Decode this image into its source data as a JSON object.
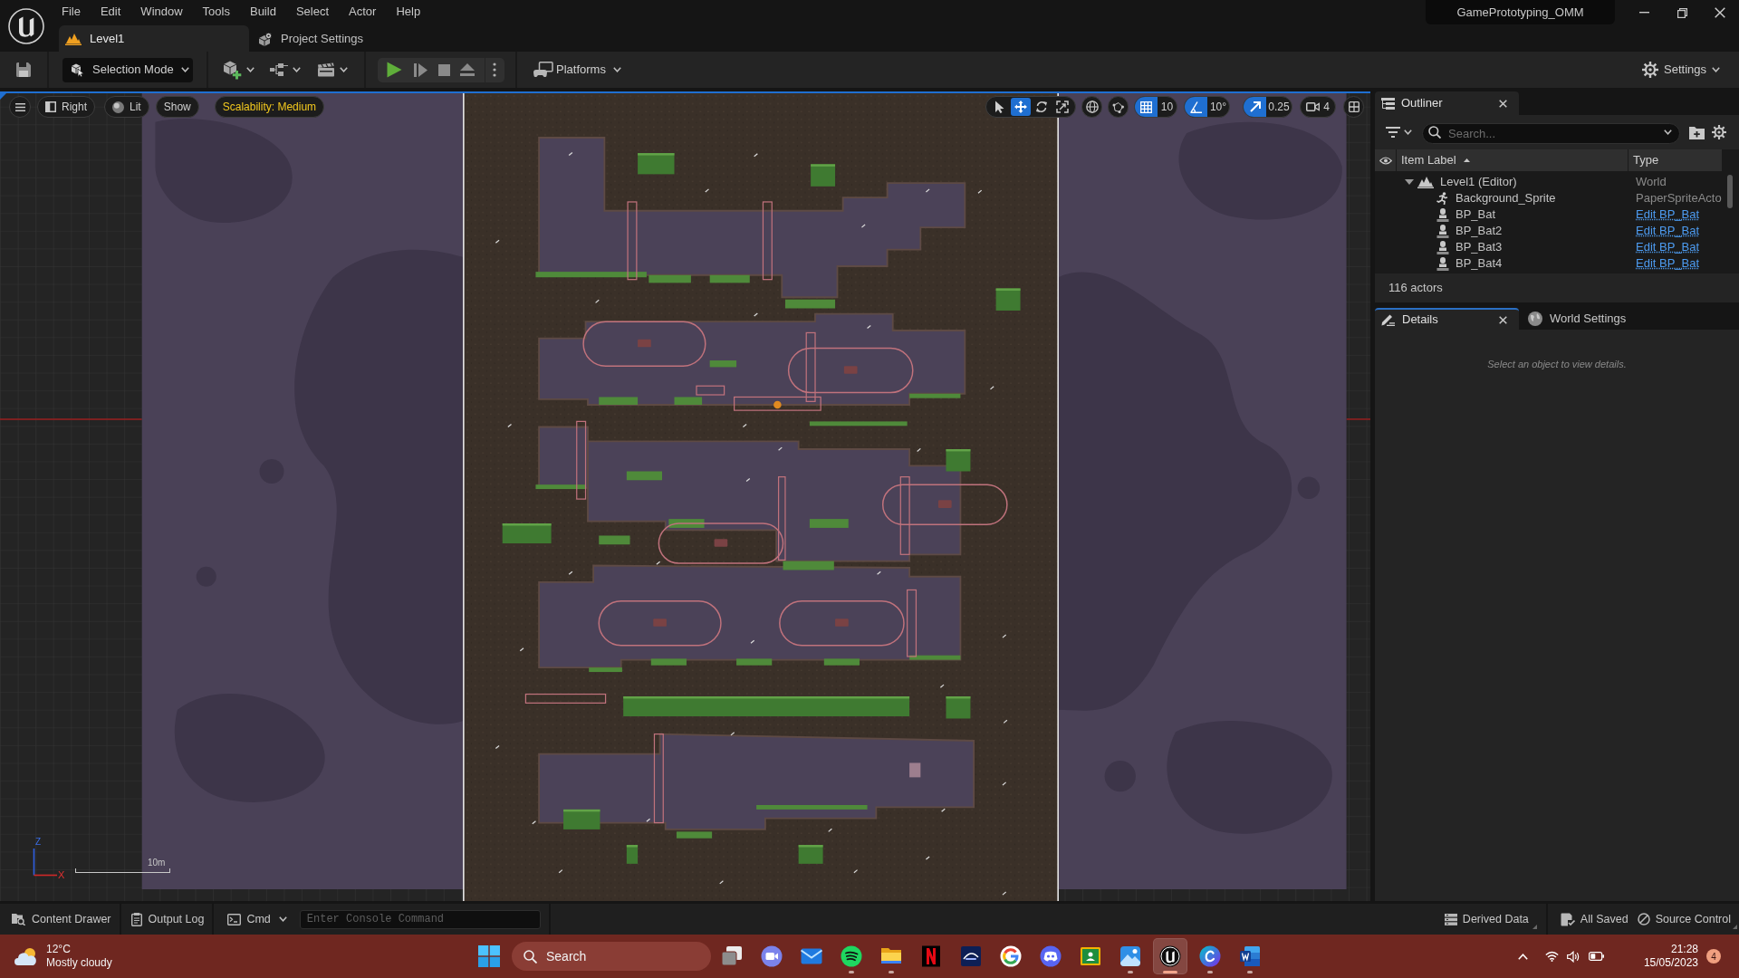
{
  "menu_bar": {
    "items": [
      "File",
      "Edit",
      "Window",
      "Tools",
      "Build",
      "Select",
      "Actor",
      "Help"
    ],
    "project": "GamePrototyping_OMM"
  },
  "document_tabs": [
    {
      "label": "Level1",
      "kind": "level",
      "selected": true
    },
    {
      "label": "Project Settings",
      "kind": "settings",
      "selected": false
    }
  ],
  "toolbar": {
    "mode": "Selection Mode",
    "platforms": "Platforms",
    "settings": "Settings"
  },
  "viewport": {
    "view_options": [
      {
        "kind": "view",
        "label": "Right"
      },
      {
        "kind": "lit",
        "label": "Lit"
      },
      {
        "kind": "show",
        "label": "Show"
      },
      {
        "kind": "scalability",
        "label": "Scalability: Medium"
      }
    ],
    "transform_tools": [
      {
        "kind": "select",
        "selected": false
      },
      {
        "kind": "move",
        "selected": true
      },
      {
        "kind": "rotate",
        "selected": false
      },
      {
        "kind": "scale",
        "selected": false
      }
    ],
    "snaps": [
      {
        "kind": "grid",
        "on": true,
        "value": "10"
      },
      {
        "kind": "angle",
        "on": true,
        "value": "10°"
      },
      {
        "kind": "scale",
        "on": true,
        "value": "0.25"
      }
    ],
    "camera_speed": "4",
    "axis_labels": [
      "Z",
      "X"
    ],
    "scale_bar": "10m"
  },
  "outliner": {
    "title": "Outliner",
    "search": {
      "placeholder": "Search..."
    },
    "columns": [
      "Item Label",
      "Type"
    ],
    "tree": [
      {
        "label": "Level1 (Editor)",
        "type": "World",
        "kind": "world",
        "expanded": true,
        "children": [
          {
            "label": "Background_Sprite",
            "type": "PaperSpriteActo",
            "kind": "sprite"
          },
          {
            "label": "BP_Bat",
            "type": "Edit BP_Bat",
            "kind": "blueprint"
          },
          {
            "label": "BP_Bat2",
            "type": "Edit BP_Bat",
            "kind": "blueprint"
          },
          {
            "label": "BP_Bat3",
            "type": "Edit BP_Bat",
            "kind": "blueprint"
          },
          {
            "label": "BP_Bat4",
            "type": "Edit BP_Bat",
            "kind": "blueprint"
          }
        ]
      }
    ],
    "actor_count": "116 actors"
  },
  "details_tabs": [
    {
      "label": "Details",
      "kind": "details",
      "selected": true
    },
    {
      "label": "World Settings",
      "kind": "world",
      "selected": false
    }
  ],
  "details_message": "Select an object to view details.",
  "status_bar": {
    "left": [
      {
        "kind": "drawer",
        "label": "Content Drawer"
      },
      {
        "kind": "log",
        "label": "Output Log"
      }
    ],
    "cmd": "Cmd",
    "console": {
      "placeholder": "Enter Console Command"
    },
    "right": [
      {
        "kind": "ddc",
        "label": "Derived Data"
      },
      {
        "kind": "saved",
        "label": "All Saved"
      },
      {
        "kind": "source",
        "label": "Source Control"
      }
    ]
  },
  "taskbar": {
    "weather": {
      "temperature": "12°C",
      "condition": "Mostly cloudy"
    },
    "search": {
      "placeholder": "Search"
    },
    "apps": [
      {
        "kind": "taskview",
        "running": false,
        "selected": false
      },
      {
        "kind": "meet",
        "running": false,
        "selected": false
      },
      {
        "kind": "mail",
        "running": false,
        "selected": false
      },
      {
        "kind": "music",
        "running": true,
        "selected": false
      },
      {
        "kind": "files",
        "running": true,
        "selected": false
      },
      {
        "kind": "video",
        "running": false,
        "selected": false
      },
      {
        "kind": "streaming",
        "running": false,
        "selected": false
      },
      {
        "kind": "browser",
        "running": false,
        "selected": false
      },
      {
        "kind": "voice",
        "running": false,
        "selected": false
      },
      {
        "kind": "classroom",
        "running": false,
        "selected": false
      },
      {
        "kind": "photos",
        "running": true,
        "selected": false
      },
      {
        "kind": "engine",
        "running": true,
        "selected": true
      },
      {
        "kind": "design",
        "running": true,
        "selected": false
      },
      {
        "kind": "writer",
        "running": true,
        "selected": false
      }
    ],
    "time": "21:28",
    "date": "15/05/2023",
    "notifications": "4"
  }
}
